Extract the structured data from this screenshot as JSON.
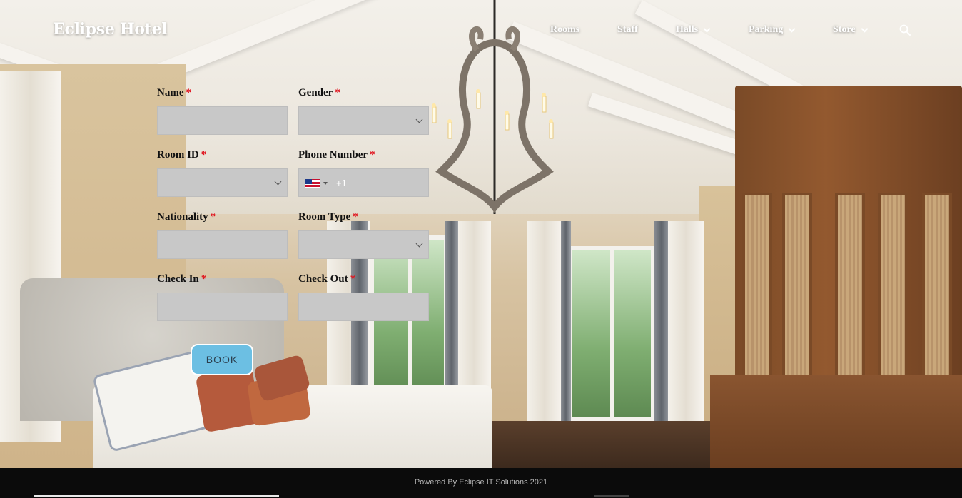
{
  "brand": {
    "name": "Eclipse Hotel"
  },
  "nav": {
    "items": [
      {
        "label": "Rooms",
        "dropdown": false
      },
      {
        "label": "Staff",
        "dropdown": false
      },
      {
        "label": "Halls",
        "dropdown": true
      },
      {
        "label": "Parking",
        "dropdown": true
      },
      {
        "label": "Store",
        "dropdown": true
      }
    ],
    "search_icon": "search-icon"
  },
  "form": {
    "required_marker": "*",
    "fields": {
      "name": {
        "label": "Name",
        "value": ""
      },
      "gender": {
        "label": "Gender",
        "value": ""
      },
      "room_id": {
        "label": "Room ID",
        "value": ""
      },
      "phone": {
        "label": "Phone Number",
        "country_code": "+1",
        "flag": "us-flag-icon"
      },
      "nationality": {
        "label": "Nationality",
        "value": ""
      },
      "room_type": {
        "label": "Room Type",
        "value": ""
      },
      "check_in": {
        "label": "Check In",
        "value": ""
      },
      "check_out": {
        "label": "Check Out",
        "value": ""
      }
    },
    "submit_label": "BOOK"
  },
  "footer": {
    "text": "Powered By Eclipse IT Solutions 2021"
  },
  "colors": {
    "field_bg": "#c8c8c8",
    "required": "#e0141e",
    "button_bg": "#6cbfe3",
    "footer_bg": "#0b0b0b"
  }
}
